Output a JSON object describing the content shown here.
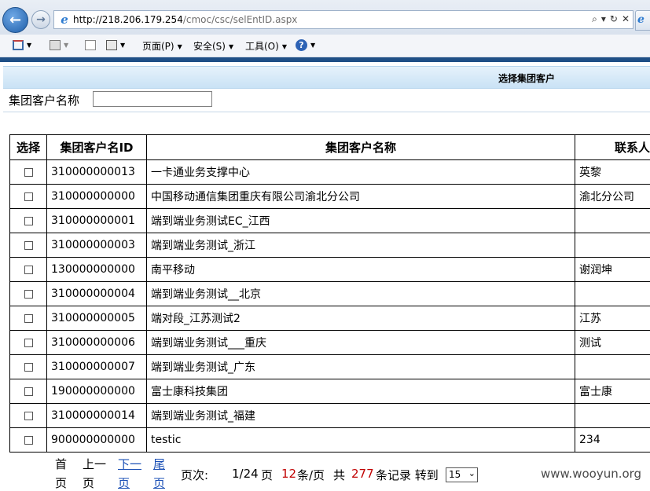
{
  "browser": {
    "url_host": "http://218.206.179.254",
    "url_path": "/cmoc/csc/selEntID.aspx",
    "addr_tools": {
      "search": "⌕",
      "dropdown": "▾",
      "refresh": "↻",
      "stop": "✕"
    },
    "tab_peek": "e"
  },
  "commandbar": {
    "page_menu": "页面(P)",
    "safety_menu": "安全(S)",
    "tools_menu": "工具(O)",
    "help_icon": "?"
  },
  "page": {
    "title": "选择集团客户",
    "search_label": "集团客户名称",
    "search_value": ""
  },
  "table": {
    "headers": [
      "选择",
      "集团客户名ID",
      "集团客户名称",
      "联系人"
    ],
    "rows": [
      {
        "id": "310000000013",
        "name": "一卡通业务支撑中心",
        "contact": "英黎"
      },
      {
        "id": "310000000000",
        "name": "中国移动通信集团重庆有限公司渝北分公司",
        "contact": "渝北分公司"
      },
      {
        "id": "310000000001",
        "name": "端到端业务测试EC_江西",
        "contact": ""
      },
      {
        "id": "310000000003",
        "name": "端到端业务测试_浙江",
        "contact": ""
      },
      {
        "id": "130000000000",
        "name": "南平移动",
        "contact": "谢润坤"
      },
      {
        "id": "310000000004",
        "name": "端到端业务测试__北京",
        "contact": ""
      },
      {
        "id": "310000000005",
        "name": "端对段_江苏测试2",
        "contact": "江苏"
      },
      {
        "id": "310000000006",
        "name": "端到端业务测试___重庆",
        "contact": "测试"
      },
      {
        "id": "310000000007",
        "name": "端到端业务测试_广东",
        "contact": ""
      },
      {
        "id": "190000000000",
        "name": "富士康科技集团",
        "contact": "富士康"
      },
      {
        "id": "310000000014",
        "name": "端到端业务测试_福建",
        "contact": ""
      },
      {
        "id": "900000000000",
        "name": "testic",
        "contact": "234"
      }
    ]
  },
  "pager": {
    "first": "首",
    "prev": "上一",
    "next": "下一",
    "last": "尾",
    "page_label": "页次:",
    "page_value": "1/24",
    "page_unit": "页",
    "per_page": "12",
    "per_page_unit": "条/页",
    "total_prefix": "共",
    "total": "277",
    "total_suffix": "条记录 转到",
    "page_size": "15",
    "row2": [
      "页",
      "页",
      "页",
      "页"
    ]
  },
  "watermark": "www.wooyun.org",
  "colors": {
    "link": "#1a4fb5",
    "highlight": "#c00000",
    "band": "#1f4f86"
  }
}
